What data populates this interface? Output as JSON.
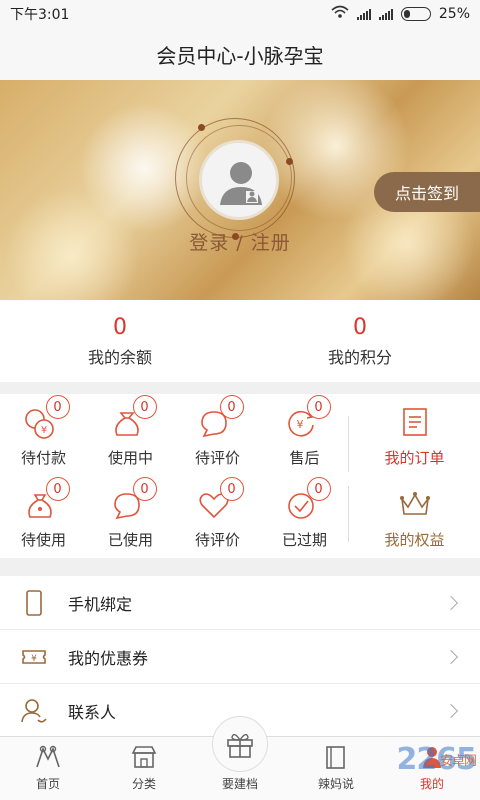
{
  "status_bar": {
    "time": "下午3:01",
    "battery": "25%",
    "battery_level": 0.25
  },
  "header": {
    "title": "会员中心-小脉孕宝"
  },
  "hero": {
    "login_text": "登录 / 注册",
    "checkin_label": "点击签到"
  },
  "stats": [
    {
      "value": "0",
      "label": "我的余额"
    },
    {
      "value": "0",
      "label": "我的积分"
    }
  ],
  "orders": {
    "items": [
      {
        "label": "待付款",
        "count": "0",
        "icon": "wallet-coin-icon"
      },
      {
        "label": "使用中",
        "count": "0",
        "icon": "money-bag-icon"
      },
      {
        "label": "待评价",
        "count": "0",
        "icon": "speech-bubble-icon"
      },
      {
        "label": "售后",
        "count": "0",
        "icon": "refund-yen-icon"
      },
      {
        "label": "待使用",
        "count": "0",
        "icon": "bag-icon"
      },
      {
        "label": "已使用",
        "count": "0",
        "icon": "bubble-icon"
      },
      {
        "label": "待评价",
        "count": "0",
        "icon": "heart-bubble-icon"
      },
      {
        "label": "已过期",
        "count": "0",
        "icon": "clock-check-icon"
      }
    ],
    "my_orders_label": "我的订单",
    "my_rights_label": "我的权益"
  },
  "menu": [
    {
      "label": "手机绑定",
      "icon": "phone-icon"
    },
    {
      "label": "我的优惠券",
      "icon": "coupon-icon"
    },
    {
      "label": "联系人",
      "icon": "contact-icon"
    }
  ],
  "tabs": [
    {
      "label": "首页",
      "icon": "home-icon"
    },
    {
      "label": "分类",
      "icon": "category-store-icon"
    },
    {
      "label": "要建档",
      "icon": "gift-icon"
    },
    {
      "label": "辣妈说",
      "icon": "book-icon"
    },
    {
      "label": "我的",
      "icon": "user-icon",
      "active": true
    }
  ],
  "watermark": {
    "text": "2265",
    "sub": "安卓网"
  },
  "colors": {
    "accent": "#d8352c",
    "gold": "#9a6a3a",
    "checkin_bg": "#8a6a4a"
  }
}
